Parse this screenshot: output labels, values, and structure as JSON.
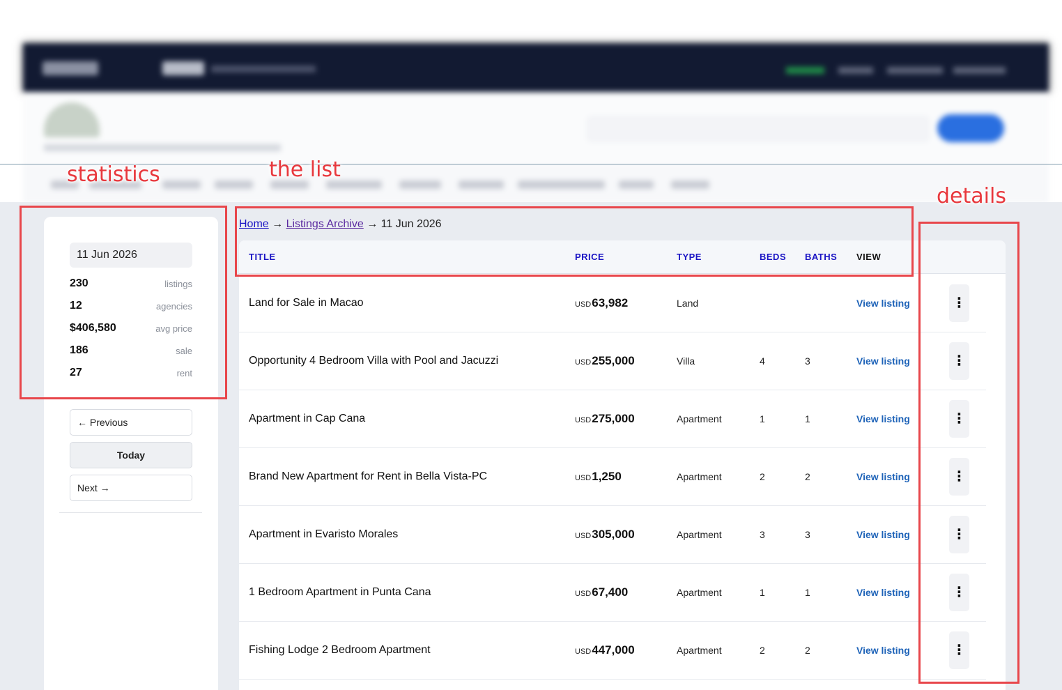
{
  "annotations": {
    "statistics": "statistics",
    "the_list": "the list",
    "details": "details"
  },
  "sidebar": {
    "date": "11 Jun 2026",
    "stats": [
      {
        "value": "230",
        "label": "listings"
      },
      {
        "value": "12",
        "label": "agencies"
      },
      {
        "value": "$406,580",
        "label": "avg price"
      },
      {
        "value": "186",
        "label": "sale"
      },
      {
        "value": "27",
        "label": "rent"
      }
    ],
    "previous_label": "← Previous",
    "today_label": "Today",
    "next_label": "Next →"
  },
  "breadcrumb": {
    "home": "Home",
    "sep1": " → ",
    "archive": "Listings Archive",
    "sep2": " → ",
    "current": "11 Jun 2026"
  },
  "table": {
    "headers": {
      "title": "TITLE",
      "price": "PRICE",
      "type": "TYPE",
      "beds": "BEDS",
      "baths": "BATHS",
      "view": "VIEW"
    },
    "currency": "USD",
    "view_label": "View listing",
    "kebab": "⋮",
    "rows": [
      {
        "title": "Land for Sale in Macao",
        "price": "63,982",
        "type": "Land",
        "beds": "",
        "baths": ""
      },
      {
        "title": "Opportunity 4 Bedroom Villa with Pool and Jacuzzi",
        "price": "255,000",
        "type": "Villa",
        "beds": "4",
        "baths": "3"
      },
      {
        "title": "Apartment in Cap Cana",
        "price": "275,000",
        "type": "Apartment",
        "beds": "1",
        "baths": "1"
      },
      {
        "title": "Brand New Apartment for Rent in Bella Vista-PC",
        "price": "1,250",
        "type": "Apartment",
        "beds": "2",
        "baths": "2"
      },
      {
        "title": "Apartment in Evaristo Morales",
        "price": "305,000",
        "type": "Apartment",
        "beds": "3",
        "baths": "3"
      },
      {
        "title": "1 Bedroom Apartment in Punta Cana",
        "price": "67,400",
        "type": "Apartment",
        "beds": "1",
        "baths": "1"
      },
      {
        "title": "Fishing Lodge 2 Bedroom Apartment",
        "price": "447,000",
        "type": "Apartment",
        "beds": "2",
        "baths": "2"
      }
    ]
  },
  "colors": {
    "accent_link": "#1e63b8",
    "header_link": "#1a14c4",
    "annotation": "#e8464b",
    "topbar": "#121a32"
  }
}
